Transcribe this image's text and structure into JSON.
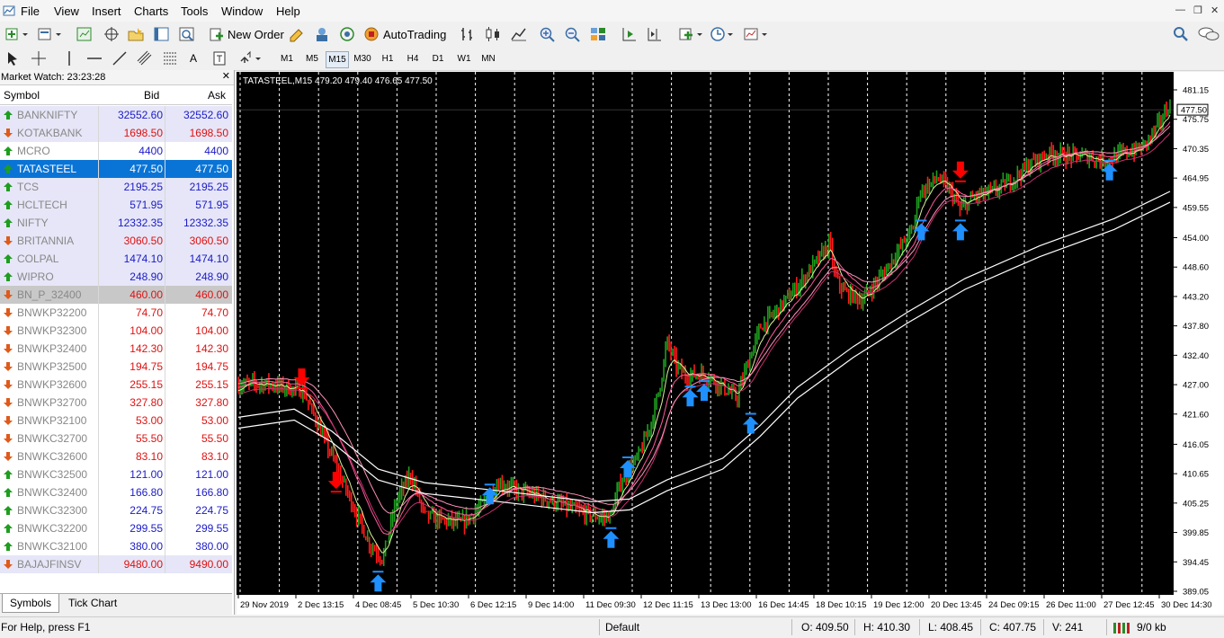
{
  "menu": {
    "items": [
      "File",
      "View",
      "Insert",
      "Charts",
      "Tools",
      "Window",
      "Help"
    ]
  },
  "toolbar": {
    "new_order": "New Order",
    "auto_trading": "AutoTrading"
  },
  "timeframes": [
    "M1",
    "M5",
    "M15",
    "M30",
    "H1",
    "H4",
    "D1",
    "W1",
    "MN"
  ],
  "active_timeframe": "M15",
  "market_watch": {
    "title": "Market Watch: 23:23:28",
    "columns": {
      "symbol": "Symbol",
      "bid": "Bid",
      "ask": "Ask"
    },
    "rows": [
      {
        "symbol": "BANKNIFTY",
        "bid": "32552.60",
        "ask": "32552.60",
        "dir": "up",
        "color": "blue",
        "bg": "lav"
      },
      {
        "symbol": "KOTAKBANK",
        "bid": "1698.50",
        "ask": "1698.50",
        "dir": "down",
        "color": "red",
        "bg": "lav"
      },
      {
        "symbol": "MCRO",
        "bid": "4400",
        "ask": "4400",
        "dir": "up",
        "color": "blue",
        "bg": "white"
      },
      {
        "symbol": "TATASTEEL",
        "bid": "477.50",
        "ask": "477.50",
        "dir": "up",
        "color": "blue",
        "bg": "sel"
      },
      {
        "symbol": "TCS",
        "bid": "2195.25",
        "ask": "2195.25",
        "dir": "up",
        "color": "blue",
        "bg": "lav"
      },
      {
        "symbol": "HCLTECH",
        "bid": "571.95",
        "ask": "571.95",
        "dir": "up",
        "color": "blue",
        "bg": "lav"
      },
      {
        "symbol": "NIFTY",
        "bid": "12332.35",
        "ask": "12332.35",
        "dir": "up",
        "color": "blue",
        "bg": "lav"
      },
      {
        "symbol": "BRITANNIA",
        "bid": "3060.50",
        "ask": "3060.50",
        "dir": "down",
        "color": "red",
        "bg": "lav"
      },
      {
        "symbol": "COLPAL",
        "bid": "1474.10",
        "ask": "1474.10",
        "dir": "up",
        "color": "blue",
        "bg": "lav"
      },
      {
        "symbol": "WIPRO",
        "bid": "248.90",
        "ask": "248.90",
        "dir": "up",
        "color": "blue",
        "bg": "lav"
      },
      {
        "symbol": "BN_P_32400",
        "bid": "460.00",
        "ask": "460.00",
        "dir": "down",
        "color": "red",
        "bg": "grey"
      },
      {
        "symbol": "BNWKP32200",
        "bid": "74.70",
        "ask": "74.70",
        "dir": "down",
        "color": "red",
        "bg": "white"
      },
      {
        "symbol": "BNWKP32300",
        "bid": "104.00",
        "ask": "104.00",
        "dir": "down",
        "color": "red",
        "bg": "white"
      },
      {
        "symbol": "BNWKP32400",
        "bid": "142.30",
        "ask": "142.30",
        "dir": "down",
        "color": "red",
        "bg": "white"
      },
      {
        "symbol": "BNWKP32500",
        "bid": "194.75",
        "ask": "194.75",
        "dir": "down",
        "color": "red",
        "bg": "white"
      },
      {
        "symbol": "BNWKP32600",
        "bid": "255.15",
        "ask": "255.15",
        "dir": "down",
        "color": "red",
        "bg": "white"
      },
      {
        "symbol": "BNWKP32700",
        "bid": "327.80",
        "ask": "327.80",
        "dir": "down",
        "color": "red",
        "bg": "white"
      },
      {
        "symbol": "BNWKP32100",
        "bid": "53.00",
        "ask": "53.00",
        "dir": "down",
        "color": "red",
        "bg": "white"
      },
      {
        "symbol": "BNWKC32700",
        "bid": "55.50",
        "ask": "55.50",
        "dir": "down",
        "color": "red",
        "bg": "white"
      },
      {
        "symbol": "BNWKC32600",
        "bid": "83.10",
        "ask": "83.10",
        "dir": "down",
        "color": "red",
        "bg": "white"
      },
      {
        "symbol": "BNWKC32500",
        "bid": "121.00",
        "ask": "121.00",
        "dir": "up",
        "color": "blue",
        "bg": "white"
      },
      {
        "symbol": "BNWKC32400",
        "bid": "166.80",
        "ask": "166.80",
        "dir": "up",
        "color": "blue",
        "bg": "white"
      },
      {
        "symbol": "BNWKC32300",
        "bid": "224.75",
        "ask": "224.75",
        "dir": "up",
        "color": "blue",
        "bg": "white"
      },
      {
        "symbol": "BNWKC32200",
        "bid": "299.55",
        "ask": "299.55",
        "dir": "up",
        "color": "blue",
        "bg": "white"
      },
      {
        "symbol": "BNWKC32100",
        "bid": "380.00",
        "ask": "380.00",
        "dir": "up",
        "color": "blue",
        "bg": "white"
      },
      {
        "symbol": "BAJAJFINSV",
        "bid": "9480.00",
        "ask": "9490.00",
        "dir": "down",
        "color": "red",
        "bg": "lav"
      }
    ],
    "tabs": [
      "Symbols",
      "Tick Chart"
    ]
  },
  "chart_data": {
    "type": "line",
    "title": "TATASTEEL,M15  479.20 479.40 476.65 477.50",
    "current_price": "477.50",
    "y_ticks": [
      "481.15",
      "475.75",
      "470.35",
      "464.95",
      "459.55",
      "454.00",
      "448.60",
      "443.20",
      "437.80",
      "432.40",
      "427.00",
      "421.60",
      "416.05",
      "410.65",
      "405.25",
      "399.85",
      "394.45",
      "389.05"
    ],
    "y_range": [
      389.05,
      481.15
    ],
    "x_ticks": [
      "29 Nov 2019",
      "2 Dec 13:15",
      "4 Dec 08:45",
      "5 Dec 10:30",
      "6 Dec 12:15",
      "9 Dec 14:00",
      "11 Dec 09:30",
      "12 Dec 11:15",
      "13 Dec 13:00",
      "16 Dec 14:45",
      "18 Dec 10:15",
      "19 Dec 12:00",
      "20 Dec 13:45",
      "24 Dec 09:15",
      "26 Dec 11:00",
      "27 Dec 12:45",
      "30 Dec 14:30"
    ],
    "price_series": [
      [
        0,
        427.0
      ],
      [
        0.03,
        427.2
      ],
      [
        0.07,
        425.8
      ],
      [
        0.1,
        414.0
      ],
      [
        0.12,
        406.0
      ],
      [
        0.14,
        398.0
      ],
      [
        0.155,
        395.0
      ],
      [
        0.17,
        406.0
      ],
      [
        0.185,
        410.5
      ],
      [
        0.2,
        403.0
      ],
      [
        0.22,
        402.0
      ],
      [
        0.24,
        401.5
      ],
      [
        0.26,
        404.5
      ],
      [
        0.28,
        409.0
      ],
      [
        0.3,
        407.5
      ],
      [
        0.33,
        406.0
      ],
      [
        0.36,
        404.0
      ],
      [
        0.39,
        402.5
      ],
      [
        0.4,
        403.0
      ],
      [
        0.41,
        409.0
      ],
      [
        0.43,
        414.0
      ],
      [
        0.445,
        421.0
      ],
      [
        0.455,
        429.0
      ],
      [
        0.46,
        435.0
      ],
      [
        0.47,
        430.5
      ],
      [
        0.48,
        428.5
      ],
      [
        0.5,
        429.0
      ],
      [
        0.52,
        426.5
      ],
      [
        0.535,
        424.5
      ],
      [
        0.545,
        430.0
      ],
      [
        0.56,
        437.5
      ],
      [
        0.58,
        441.0
      ],
      [
        0.6,
        445.0
      ],
      [
        0.62,
        449.5
      ],
      [
        0.635,
        453.0
      ],
      [
        0.64,
        447.0
      ],
      [
        0.65,
        444.0
      ],
      [
        0.67,
        442.5
      ],
      [
        0.69,
        447.0
      ],
      [
        0.71,
        452.0
      ],
      [
        0.725,
        456.0
      ],
      [
        0.73,
        462.0
      ],
      [
        0.75,
        465.0
      ],
      [
        0.76,
        463.5
      ],
      [
        0.77,
        461.0
      ],
      [
        0.775,
        459.0
      ],
      [
        0.79,
        461.5
      ],
      [
        0.81,
        462.5
      ],
      [
        0.83,
        464.5
      ],
      [
        0.85,
        467.5
      ],
      [
        0.87,
        469.5
      ],
      [
        0.89,
        469.0
      ],
      [
        0.91,
        469.0
      ],
      [
        0.93,
        468.0
      ],
      [
        0.95,
        469.5
      ],
      [
        0.97,
        470.5
      ],
      [
        0.985,
        474.0
      ],
      [
        1.0,
        478.5
      ]
    ],
    "slow_ma": [
      [
        0,
        420.0
      ],
      [
        0.06,
        421.5
      ],
      [
        0.1,
        417.5
      ],
      [
        0.15,
        410.5
      ],
      [
        0.2,
        408.0
      ],
      [
        0.28,
        406.5
      ],
      [
        0.38,
        404.5
      ],
      [
        0.42,
        405.0
      ],
      [
        0.46,
        408.5
      ],
      [
        0.52,
        412.5
      ],
      [
        0.56,
        418.5
      ],
      [
        0.6,
        425.5
      ],
      [
        0.66,
        433.0
      ],
      [
        0.72,
        439.5
      ],
      [
        0.78,
        445.5
      ],
      [
        0.86,
        451.5
      ],
      [
        0.94,
        456.5
      ],
      [
        1.0,
        461.5
      ]
    ],
    "down_signals": [
      [
        0.068,
        428.5
      ],
      [
        0.105,
        409.5
      ],
      [
        0.775,
        466.5
      ]
    ],
    "up_signals": [
      [
        0.15,
        390.5
      ],
      [
        0.27,
        406.5
      ],
      [
        0.4,
        398.5
      ],
      [
        0.418,
        411.5
      ],
      [
        0.485,
        424.5
      ],
      [
        0.5,
        425.5
      ],
      [
        0.55,
        419.5
      ],
      [
        0.733,
        455.0
      ],
      [
        0.775,
        455.0
      ],
      [
        0.935,
        466.0
      ]
    ]
  },
  "status": {
    "help": "For Help, press F1",
    "profile": "Default",
    "o": "O: 409.50",
    "h": "H: 410.30",
    "l": "L: 408.45",
    "c": "C: 407.75",
    "v": "V: 241",
    "traffic": "9/0 kb"
  },
  "colors": {
    "bull": "#1e9e1e",
    "bear": "#ff1a1a",
    "selection": "#0a74d6",
    "signal_up": "#1e90ff",
    "signal_down": "#ff0000"
  }
}
